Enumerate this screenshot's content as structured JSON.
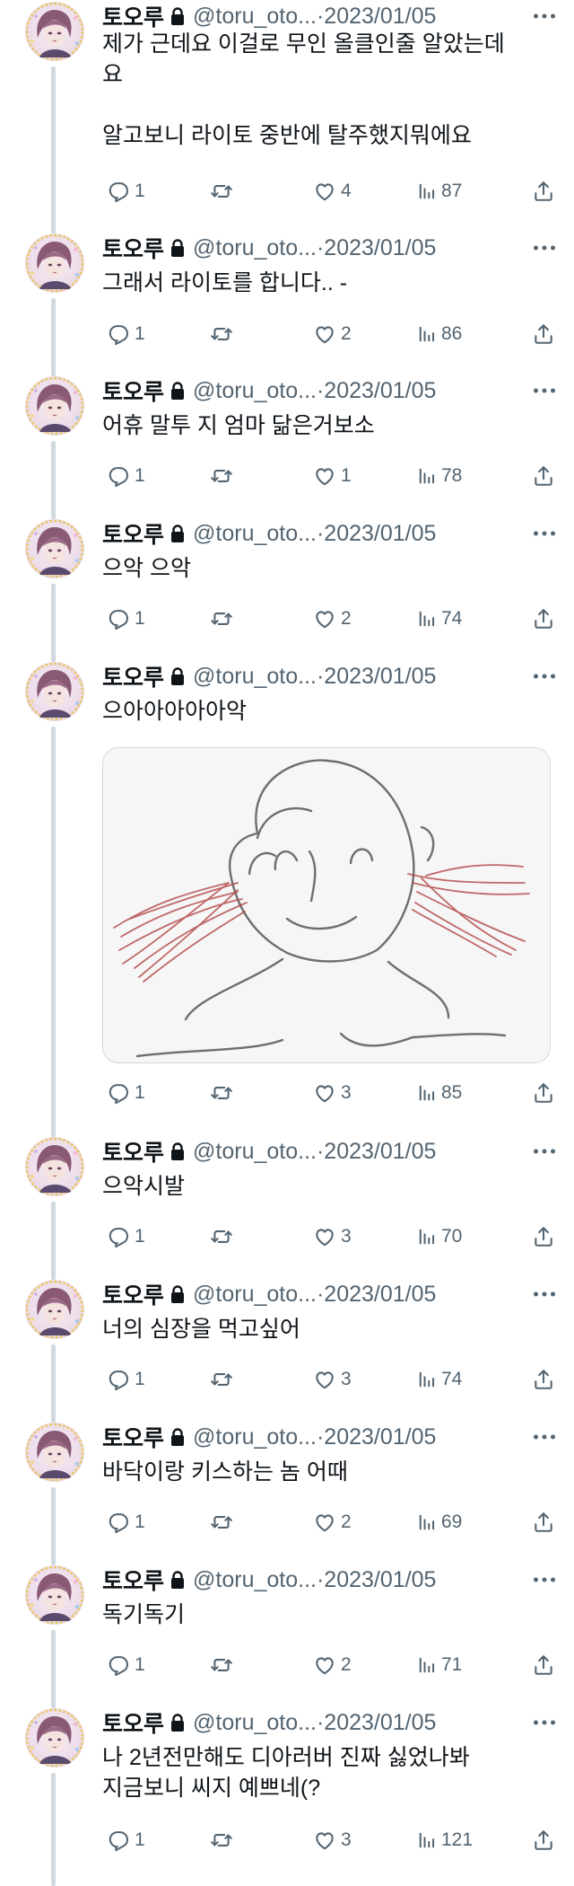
{
  "tweets": [
    {
      "name": "토오루",
      "handle": "@toru_oto...",
      "date": "2023/01/05",
      "text": "제가 근데요 이걸로 무인 올클인줄 알았는데\n요\n\n알고보니 라이토 중반에 탈주했지뭐에요",
      "replies": "1",
      "likes": "4",
      "views": "87"
    },
    {
      "name": "토오루",
      "handle": "@toru_oto...",
      "date": "2023/01/05",
      "text": "그래서 라이토를 합니다.. -",
      "replies": "1",
      "likes": "2",
      "views": "86"
    },
    {
      "name": "토오루",
      "handle": "@toru_oto...",
      "date": "2023/01/05",
      "text": "어휴 말투 지 엄마 닮은거보소",
      "replies": "1",
      "likes": "1",
      "views": "78"
    },
    {
      "name": "토오루",
      "handle": "@toru_oto...",
      "date": "2023/01/05",
      "text": "으악 으악",
      "replies": "1",
      "likes": "2",
      "views": "74"
    },
    {
      "name": "토오루",
      "handle": "@toru_oto...",
      "date": "2023/01/05",
      "text": "으아아아아아악",
      "replies": "1",
      "likes": "3",
      "views": "85",
      "media": "doodle-face-drawing"
    },
    {
      "name": "토오루",
      "handle": "@toru_oto...",
      "date": "2023/01/05",
      "text": "으악시발",
      "replies": "1",
      "likes": "3",
      "views": "70"
    },
    {
      "name": "토오루",
      "handle": "@toru_oto...",
      "date": "2023/01/05",
      "text": "너의 심장을 먹고싶어",
      "replies": "1",
      "likes": "3",
      "views": "74"
    },
    {
      "name": "토오루",
      "handle": "@toru_oto...",
      "date": "2023/01/05",
      "text": "바닥이랑 키스하는 놈 어때",
      "replies": "1",
      "likes": "2",
      "views": "69"
    },
    {
      "name": "토오루",
      "handle": "@toru_oto...",
      "date": "2023/01/05",
      "text": "독기독기",
      "replies": "1",
      "likes": "2",
      "views": "71"
    },
    {
      "name": "토오루",
      "handle": "@toru_oto...",
      "date": "2023/01/05",
      "text": "나 2년전만해도 디아러버 진짜 싫었나봐\n지금보니 씨지 예쁘네(?",
      "replies": "1",
      "likes": "3",
      "views": "121"
    }
  ],
  "separator": " · ",
  "icons": {
    "reply": "reply-icon",
    "retweet": "retweet-icon",
    "like": "heart-icon",
    "views": "views-chart-icon",
    "share": "share-icon",
    "lock": "lock-icon",
    "more": "more-dots-icon"
  },
  "colors": {
    "text": "#0f1419",
    "secondary": "#536471",
    "thread": "#cfd9de",
    "divider": "#eff3f4"
  }
}
